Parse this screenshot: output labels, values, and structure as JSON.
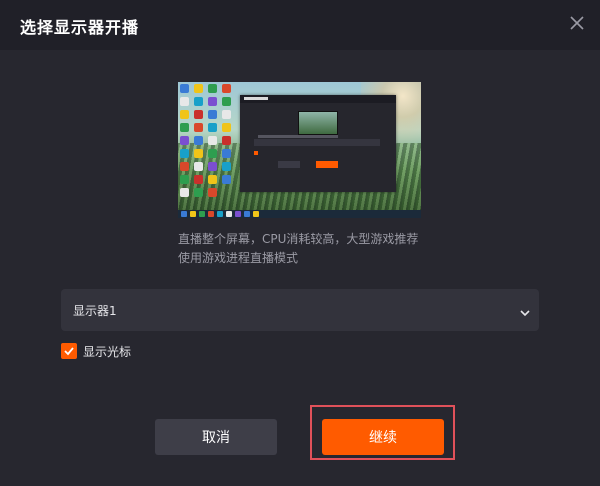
{
  "dialog": {
    "title": "选择显示器开播",
    "close_icon": "close-icon"
  },
  "preview": {
    "mini_dialog_title": "",
    "icon_colors": [
      "#3a7bd5",
      "#f0c419",
      "#2e9e4f",
      "#d9482b",
      "#7b4fd0",
      "#18a0c9",
      "#e8e8e8",
      "#c9302c"
    ]
  },
  "description": "直播整个屏幕，CPU消耗较高，大型游戏推荐使用游戏进程直播模式",
  "monitor_select": {
    "value": "显示器1",
    "arrow_icon": "chevron-down-icon"
  },
  "show_cursor": {
    "label": "显示光标",
    "checked": true
  },
  "buttons": {
    "cancel_label": "取消",
    "continue_label": "继续"
  },
  "colors": {
    "accent": "#ff5b00",
    "background": "#27272f",
    "header": "#202028",
    "highlight": "#e0515a"
  }
}
